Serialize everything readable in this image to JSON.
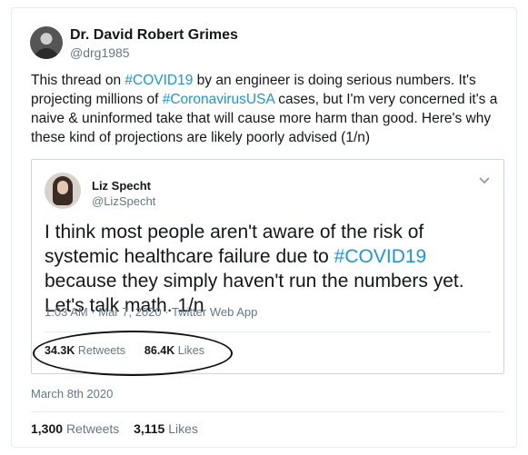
{
  "author": {
    "name": "Dr. David Robert Grimes",
    "handle": "@drg1985"
  },
  "tweet": {
    "text_parts": [
      {
        "text": "This thread on ",
        "tag": false
      },
      {
        "text": "#COVID19",
        "tag": true
      },
      {
        "text": " by an engineer is doing serious numbers. It's projecting millions of ",
        "tag": false
      },
      {
        "text": "#CoronavirusUSA",
        "tag": true
      },
      {
        "text": " cases, but I'm very concerned it's a naive & uninformed take that will cause more harm than good. Here's why these kind of projections are likely poorly advised (1/n)",
        "tag": false
      }
    ],
    "date": "March 8th 2020",
    "retweets_count": "1,300",
    "retweets_label": "Retweets",
    "likes_count": "3,115",
    "likes_label": "Likes"
  },
  "quoted": {
    "name": "Liz Specht",
    "handle": "@LizSpecht",
    "text_parts": [
      {
        "text": "I think most people aren't aware of the risk of systemic healthcare failure due to ",
        "tag": false
      },
      {
        "text": "#COVID19",
        "tag": true
      },
      {
        "text": " because they simply haven't run the numbers yet. Let's talk math. 1/n",
        "tag": false
      }
    ],
    "timestamp": "1:03 AM · Mar 7, 2020 · Twitter Web App",
    "retweets_count": "34.3K",
    "retweets_label": "Retweets",
    "likes_count": "86.4K",
    "likes_label": "Likes"
  },
  "colors": {
    "link": "#1b95e0",
    "secondary_text": "#657786",
    "border": "#ccd6dd"
  }
}
